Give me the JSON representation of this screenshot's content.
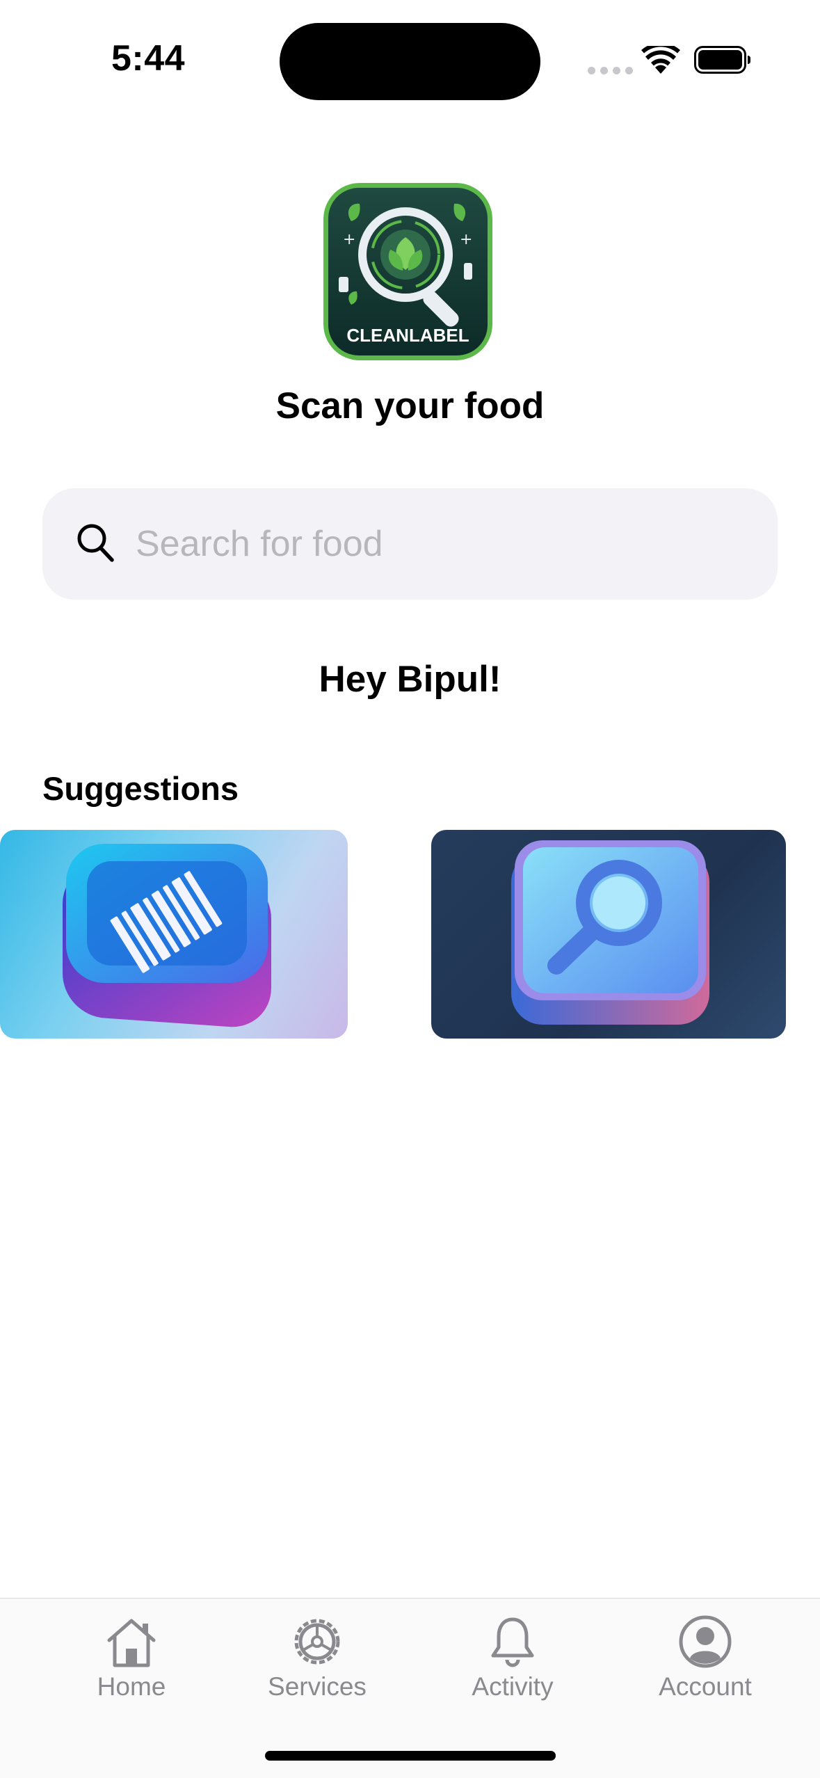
{
  "status_bar": {
    "time": "5:44"
  },
  "app": {
    "logo_text": "CLEANLABEL",
    "heading": "Scan your food"
  },
  "search": {
    "placeholder": "Search for food",
    "value": ""
  },
  "greeting": "Hey Bipul!",
  "suggestions": {
    "title": "Suggestions",
    "cards": [
      {
        "icon": "barcode-scan-icon"
      },
      {
        "icon": "magnifier-search-icon"
      }
    ]
  },
  "tabbar": {
    "items": [
      {
        "label": "Home",
        "icon": "house-icon"
      },
      {
        "label": "Services",
        "icon": "gear-icon"
      },
      {
        "label": "Activity",
        "icon": "bell-icon"
      },
      {
        "label": "Account",
        "icon": "person-circle-icon"
      }
    ]
  },
  "colors": {
    "search_bg": "#f2f2f7",
    "placeholder": "#b6b6bb",
    "tab_inactive": "#8a8a8e",
    "logo_green": "#5cb848",
    "logo_dark": "#123a34"
  }
}
